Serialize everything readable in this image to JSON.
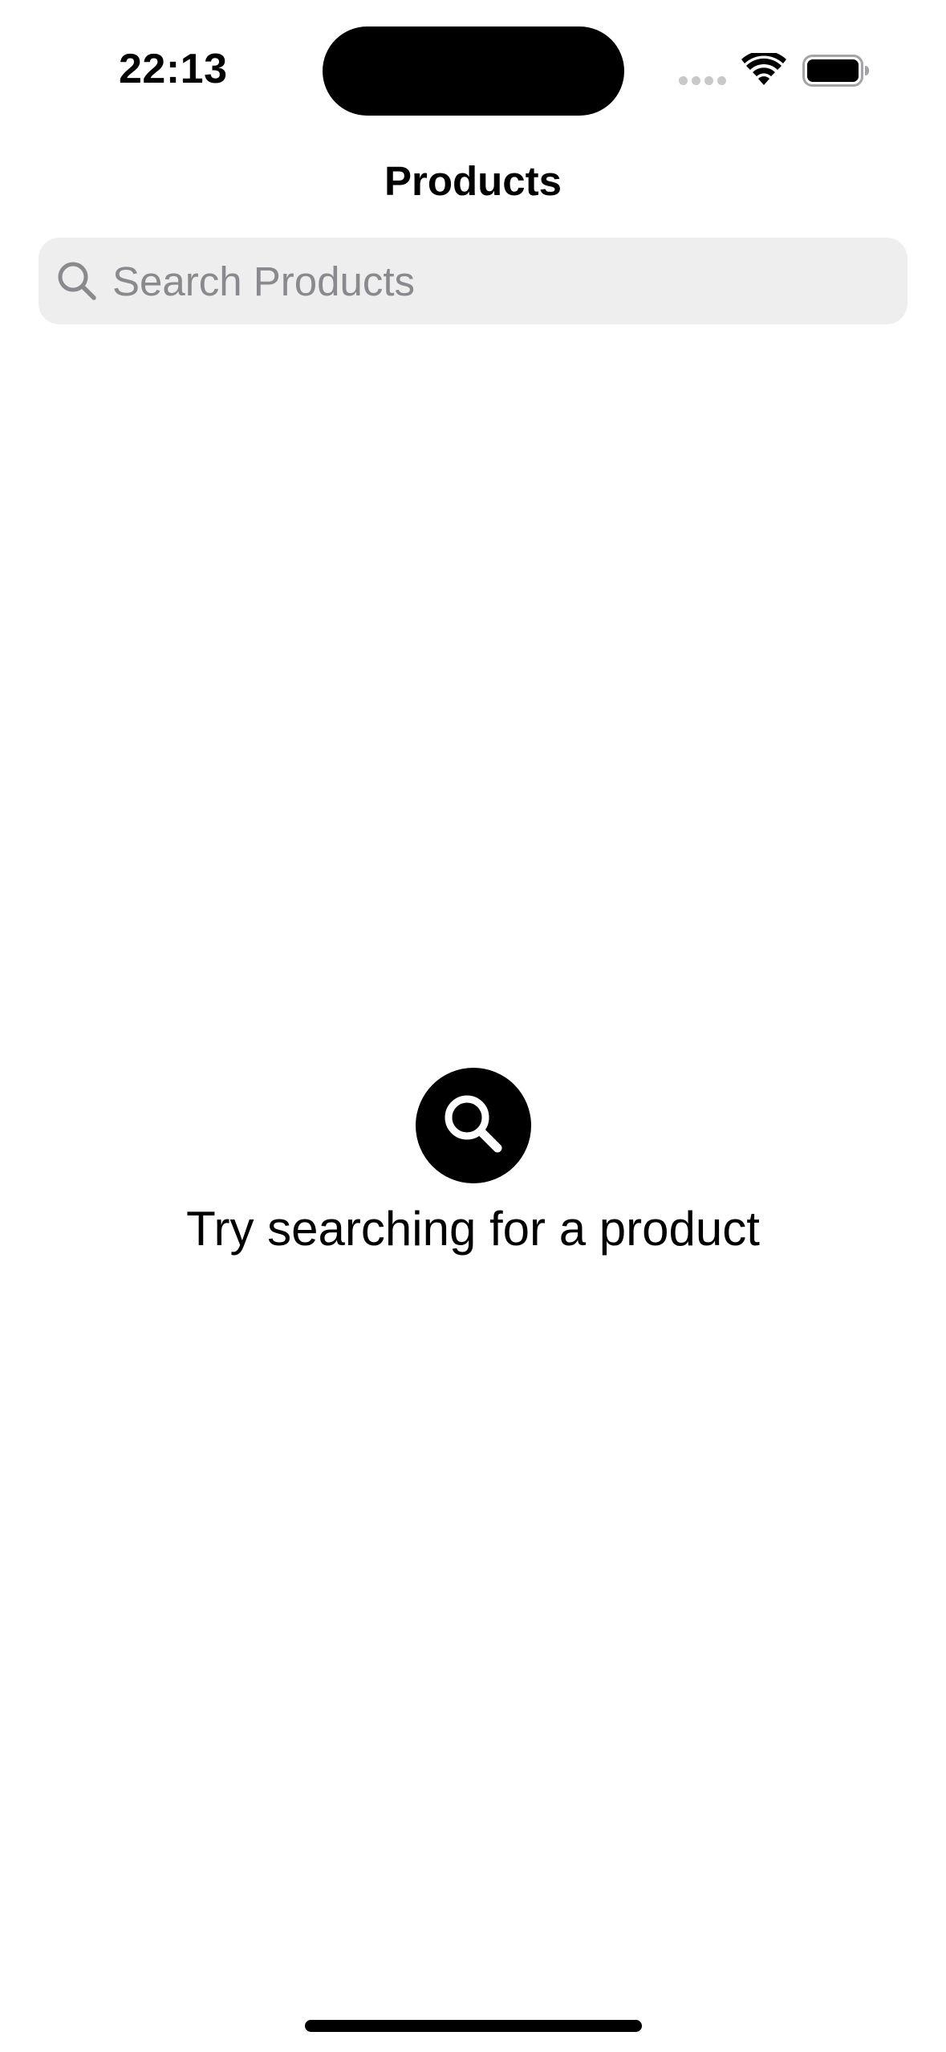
{
  "status_bar": {
    "time": "22:13",
    "icons": [
      "cellular-signal-icon",
      "wifi-icon",
      "battery-icon"
    ]
  },
  "nav": {
    "title": "Products"
  },
  "search": {
    "placeholder": "Search Products",
    "value": "",
    "icon": "search-icon"
  },
  "empty_state": {
    "icon": "magnifying-glass-circle-icon",
    "message": "Try searching for a product"
  },
  "colors": {
    "background": "#ffffff",
    "search_field_bg": "#eeeeef",
    "placeholder": "#8a8a8e",
    "text": "#000000"
  }
}
